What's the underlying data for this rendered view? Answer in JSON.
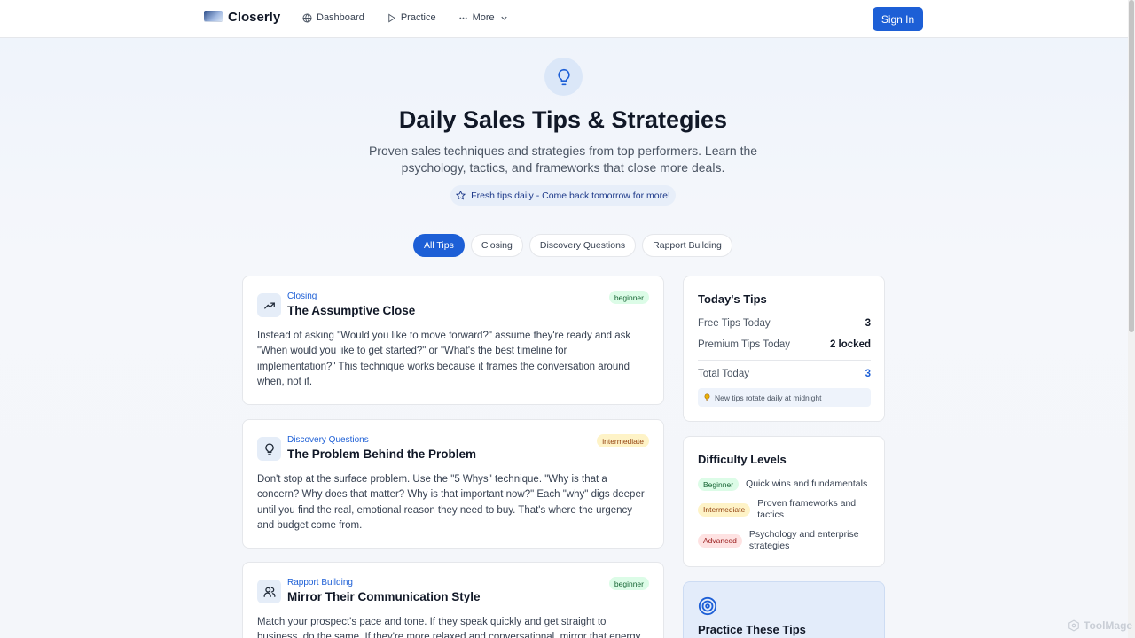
{
  "brand": {
    "name": "Closerly"
  },
  "nav": {
    "items": [
      {
        "label": "Dashboard",
        "icon": "globe-icon"
      },
      {
        "label": "Practice",
        "icon": "play-icon"
      },
      {
        "label": "More",
        "icon": "ellipsis-icon"
      }
    ],
    "signin_label": "Sign In"
  },
  "hero": {
    "title": "Daily Sales Tips & Strategies",
    "subtitle": "Proven sales techniques and strategies from top performers. Learn the psychology, tactics, and frameworks that close more deals.",
    "fresh_note": "Fresh tips daily - Come back tomorrow for more!"
  },
  "tabs": [
    "All Tips",
    "Closing",
    "Discovery Questions",
    "Rapport Building"
  ],
  "tips": [
    {
      "category": "Closing",
      "title": "The Assumptive Close",
      "level": "beginner",
      "icon": "trending-up-icon",
      "body": "Instead of asking \"Would you like to move forward?\" assume they're ready and ask \"When would you like to get started?\" or \"What's the best timeline for implementation?\" This technique works because it frames the conversation around when, not if."
    },
    {
      "category": "Discovery Questions",
      "title": "The Problem Behind the Problem",
      "level": "intermediate",
      "icon": "lightbulb-icon",
      "body": "Don't stop at the surface problem. Use the \"5 Whys\" technique. \"Why is that a concern? Why does that matter? Why is that important now?\" Each \"why\" digs deeper until you find the real, emotional reason they need to buy. That's where the urgency and budget come from."
    },
    {
      "category": "Rapport Building",
      "title": "Mirror Their Communication Style",
      "level": "beginner",
      "icon": "users-icon",
      "body": "Match your prospect's pace and tone. If they speak quickly and get straight to business, do the same. If they're more relaxed and conversational, mirror that energy."
    }
  ],
  "today": {
    "title": "Today's Tips",
    "free_label": "Free Tips Today",
    "free_value": "3",
    "premium_label": "Premium Tips Today",
    "premium_value": "2 locked",
    "total_label": "Total Today",
    "total_value": "3",
    "note": "New tips rotate daily at midnight"
  },
  "levels": {
    "title": "Difficulty Levels",
    "items": [
      {
        "badge": "Beginner",
        "desc": "Quick wins and fundamentals"
      },
      {
        "badge": "Intermediate",
        "desc": "Proven frameworks and tactics"
      },
      {
        "badge": "Advanced",
        "desc": "Psychology and enterprise strategies"
      }
    ]
  },
  "practice": {
    "title": "Practice These Tips"
  },
  "watermark": "ToolMage",
  "colors": {
    "accent": "#1d5fd6",
    "beginner": "#dcfce7",
    "intermediate": "#fef3c7",
    "advanced": "#fee2e2"
  }
}
